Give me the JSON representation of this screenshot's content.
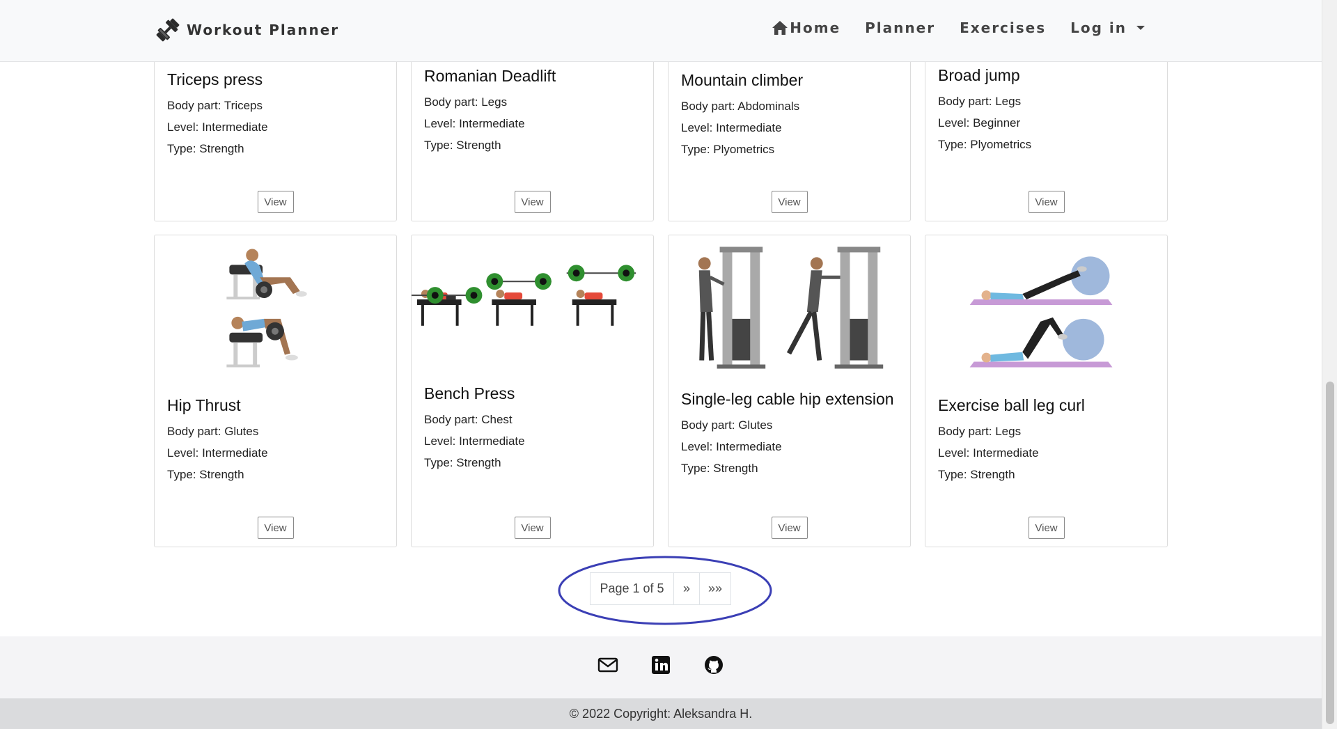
{
  "navbar": {
    "brand": "Workout Planner",
    "home": "Home",
    "planner": "Planner",
    "exercises": "Exercises",
    "login": "Log in"
  },
  "cards": [
    {
      "title": "Triceps press",
      "body_part": "Body part: Triceps",
      "level": "Level: Intermediate",
      "type": "Type: Strength",
      "button": "View"
    },
    {
      "title": "Romanian Deadlift",
      "body_part": "Body part: Legs",
      "level": "Level: Intermediate",
      "type": "Type: Strength",
      "button": "View"
    },
    {
      "title": "Mountain climber",
      "body_part": "Body part: Abdominals",
      "level": "Level: Intermediate",
      "type": "Type: Plyometrics",
      "button": "View"
    },
    {
      "title": "Broad jump",
      "body_part": "Body part: Legs",
      "level": "Level: Beginner",
      "type": "Type: Plyometrics",
      "button": "View"
    },
    {
      "title": "Hip Thrust",
      "body_part": "Body part: Glutes",
      "level": "Level: Intermediate",
      "type": "Type: Strength",
      "button": "View"
    },
    {
      "title": "Bench Press",
      "body_part": "Body part: Chest",
      "level": "Level: Intermediate",
      "type": "Type: Strength",
      "button": "View"
    },
    {
      "title": "Single-leg cable hip extension",
      "body_part": "Body part: Glutes",
      "level": "Level: Intermediate",
      "type": "Type: Strength",
      "button": "View"
    },
    {
      "title": "Exercise ball leg curl",
      "body_part": "Body part: Legs",
      "level": "Level: Intermediate",
      "type": "Type: Strength",
      "button": "View"
    }
  ],
  "pagination": {
    "info": "Page 1 of 5",
    "next": "»",
    "last": "»»"
  },
  "footer": {
    "icons": [
      "envelope-icon",
      "linkedin-icon",
      "github-icon"
    ],
    "copyright": "© 2022 Copyright: Aleksandra H."
  },
  "colors": {
    "annotation_ellipse": "#3b3fb5",
    "navbar_bg": "#f8f9fa",
    "footer_bg": "#dadbdd"
  }
}
